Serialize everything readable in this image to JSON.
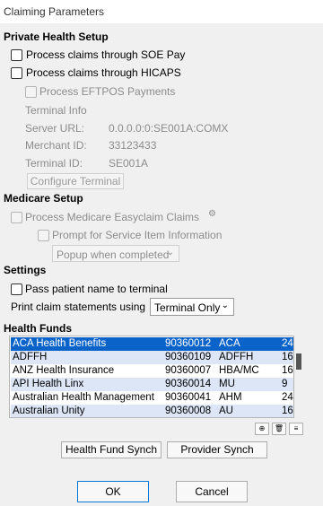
{
  "window": {
    "title": "Claiming Parameters"
  },
  "private": {
    "heading": "Private Health Setup",
    "soe_label": "Process claims through SOE Pay",
    "hicaps_label": "Process claims through HICAPS",
    "eftpos_label": "Process EFTPOS Payments",
    "terminal_info": "Terminal Info",
    "server_label": "Server URL:",
    "server_value": "0.0.0.0:0:SE001A:COMX",
    "merchant_label": "Merchant ID:",
    "merchant_value": "33123433",
    "terminal_label": "Terminal ID:",
    "terminal_value": "SE001A",
    "configure_label": "Configure Terminal"
  },
  "medicare": {
    "heading": "Medicare Setup",
    "easyclaim_label": "Process Medicare Easyclaim Claims",
    "prompt_label": "Prompt for Service Item Information",
    "popup_value": "Popup when completed"
  },
  "settings": {
    "heading": "Settings",
    "pass_label": "Pass patient name to terminal",
    "print_label": "Print claim statements using",
    "print_value": "Terminal Only"
  },
  "funds": {
    "heading": "Health Funds",
    "rows": [
      {
        "name": "ACA Health Benefits",
        "number": "90360012",
        "code": "ACA",
        "extra": "24"
      },
      {
        "name": "ADFFH",
        "number": "90360109",
        "code": "ADFFH",
        "extra": "16"
      },
      {
        "name": "ANZ Health Insurance",
        "number": "90360007",
        "code": "HBA/MC",
        "extra": "16"
      },
      {
        "name": "API Health Linx",
        "number": "90360014",
        "code": "MU",
        "extra": "9"
      },
      {
        "name": "Australian Health Management",
        "number": "90360041",
        "code": "AHM",
        "extra": "24"
      },
      {
        "name": "Australian Unity",
        "number": "90360008",
        "code": "AU",
        "extra": "16"
      }
    ],
    "selected_index": 0,
    "sync_label": "Health Fund Synch",
    "provider_label": "Provider Synch"
  },
  "footer": {
    "ok_label": "OK",
    "cancel_label": "Cancel"
  }
}
